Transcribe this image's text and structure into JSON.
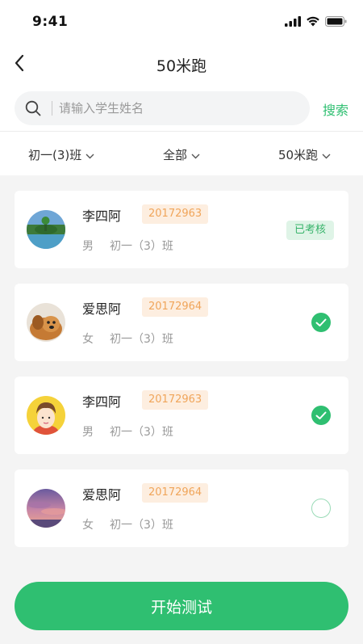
{
  "status_bar": {
    "time": "9:41"
  },
  "nav": {
    "title": "50米跑"
  },
  "search": {
    "placeholder": "请输入学生姓名",
    "value": "",
    "button_label": "搜索"
  },
  "filters": [
    {
      "label": "初一(3)班"
    },
    {
      "label": "全部"
    },
    {
      "label": "50米跑"
    }
  ],
  "students": [
    {
      "name": "李四阿",
      "id": "20172963",
      "gender": "男",
      "class": "初一（3）班",
      "status": "已考核",
      "avatar": "landscape-avatar"
    },
    {
      "name": "爱思阿",
      "id": "20172964",
      "gender": "女",
      "class": "初一（3）班",
      "checked": true,
      "avatar": "dog-avatar"
    },
    {
      "name": "李四阿",
      "id": "20172963",
      "gender": "男",
      "class": "初一（3）班",
      "checked": true,
      "avatar": "cartoon-boy-avatar"
    },
    {
      "name": "爱思阿",
      "id": "20172964",
      "gender": "女",
      "class": "初一（3）班",
      "checked": false,
      "avatar": "sunset-avatar"
    }
  ],
  "start_button": {
    "label": "开始测试"
  },
  "colors": {
    "accent": "#2fbf71",
    "badge_bg": "#fdeee0",
    "badge_text": "#f0a55a",
    "page_bg": "#f4f4f4"
  }
}
